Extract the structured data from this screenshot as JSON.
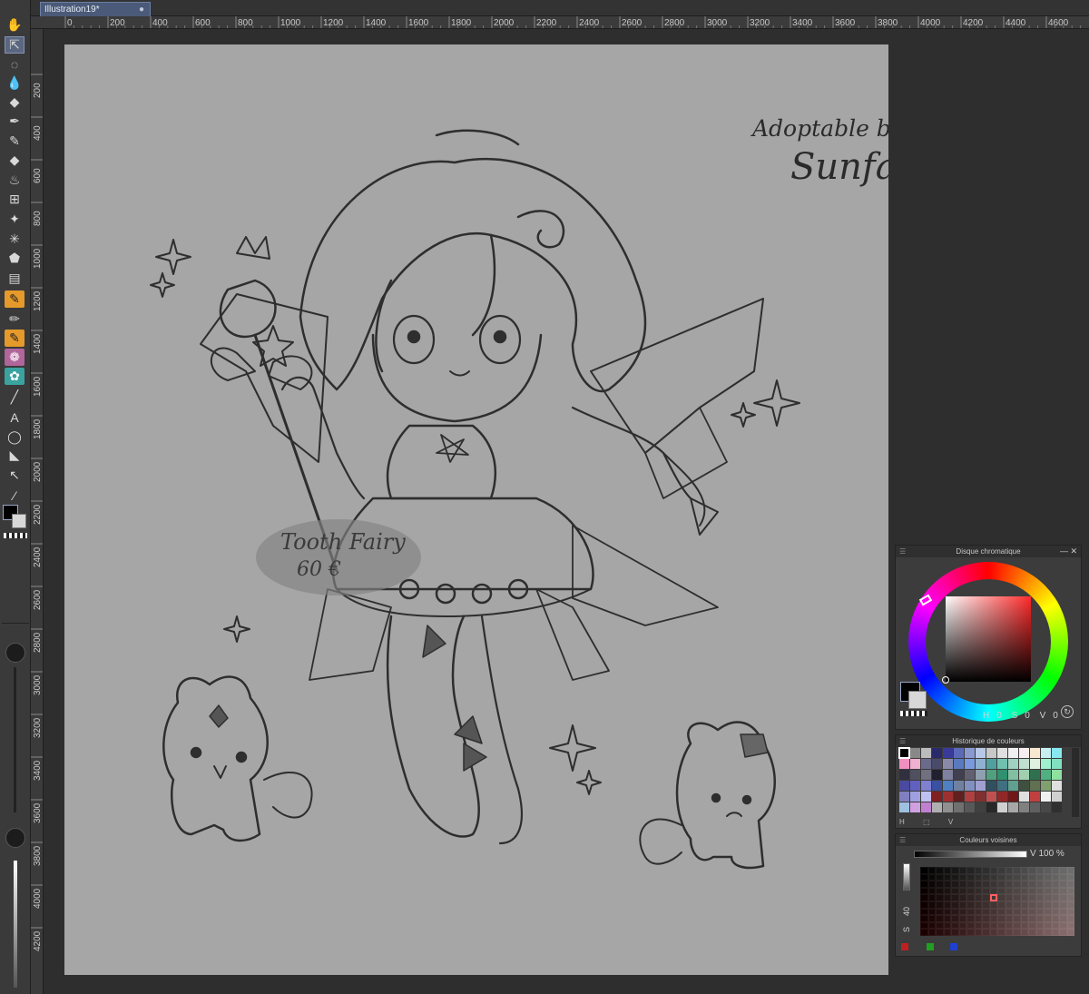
{
  "document": {
    "tab_title": "Illustration19*",
    "tab_close": "●"
  },
  "rulers": {
    "top_labels": [
      "0",
      "200",
      "400",
      "600",
      "800",
      "1000",
      "1200",
      "1400",
      "1600",
      "1800",
      "2000",
      "2200",
      "2400",
      "2600",
      "2800",
      "3000",
      "3200",
      "3400",
      "3600",
      "3800",
      "4000",
      "4200",
      "4400",
      "4600"
    ],
    "left_labels": [
      "200",
      "400",
      "600",
      "800",
      "1000",
      "1200",
      "1400",
      "1600",
      "1800",
      "2000",
      "2200",
      "2400",
      "2600",
      "2800",
      "3000",
      "3200",
      "3400",
      "3600",
      "3800",
      "4000",
      "4200"
    ]
  },
  "toolbar": {
    "tools": [
      {
        "name": "hand-tool",
        "icon": "hand-icon",
        "glyph": "✋"
      },
      {
        "name": "move-tool",
        "icon": "move-layer-icon",
        "glyph": "⇱"
      },
      {
        "name": "lasso-tool",
        "icon": "lasso-icon",
        "glyph": "◌"
      },
      {
        "name": "fill-tool",
        "icon": "drops-icon",
        "glyph": "💧"
      },
      {
        "name": "eraser-tool",
        "icon": "eraser-icon",
        "glyph": "◆"
      },
      {
        "name": "pen-tool",
        "icon": "pen-nib-icon",
        "glyph": "✒"
      },
      {
        "name": "pencil-tool",
        "icon": "pencil-icon",
        "glyph": "✎"
      },
      {
        "name": "eraser-tool-2",
        "icon": "eraser-icon",
        "glyph": "◆"
      },
      {
        "name": "blend-tool",
        "icon": "blend-icon",
        "glyph": "♨"
      },
      {
        "name": "grid-tool",
        "icon": "grid-icon",
        "glyph": "⊞"
      },
      {
        "name": "sparkle-tool",
        "icon": "sparkle-icon",
        "glyph": "✦"
      },
      {
        "name": "burst-tool",
        "icon": "burst-icon",
        "glyph": "✳"
      },
      {
        "name": "bucket-tool",
        "icon": "bucket-icon",
        "glyph": "⬟"
      },
      {
        "name": "gradient-tool",
        "icon": "gradient-icon",
        "glyph": "▤"
      },
      {
        "name": "brush-preset-1",
        "icon": "brush-icon",
        "glyph": "✎"
      },
      {
        "name": "pencil-preset",
        "icon": "pencil-icon",
        "glyph": "✏"
      },
      {
        "name": "brush-preset-2",
        "icon": "brush-icon",
        "glyph": "✎"
      },
      {
        "name": "watercolor-preset",
        "icon": "watercolor-icon",
        "glyph": "❁"
      },
      {
        "name": "texture-preset",
        "icon": "texture-icon",
        "glyph": "✿"
      },
      {
        "name": "line-tool",
        "icon": "line-icon",
        "glyph": "╱"
      },
      {
        "name": "text-tool",
        "icon": "text-icon",
        "glyph": "A"
      },
      {
        "name": "balloon-tool",
        "icon": "speech-balloon-icon",
        "glyph": "◯"
      },
      {
        "name": "frame-tool",
        "icon": "frame-icon",
        "glyph": "◣"
      },
      {
        "name": "object-tool",
        "icon": "object-select-icon",
        "glyph": "↖"
      },
      {
        "name": "eyedropper-tool",
        "icon": "eyedropper-icon",
        "glyph": "⁄"
      }
    ]
  },
  "artwork": {
    "signature_line1": "Adoptable by",
    "signature_line2": "Sunfangs",
    "price_title": "Tooth Fairy",
    "price_value": "60 €"
  },
  "color_wheel_panel": {
    "title": "Disque chromatique",
    "main_color": "#000000",
    "sub_color": "#d8d8d8",
    "readout_h_label": "H",
    "readout_h": "0",
    "readout_s_label": "S",
    "readout_s": "0",
    "readout_v_label": "V",
    "readout_v": "0"
  },
  "history_panel": {
    "title": "Historique de couleurs",
    "colors": [
      "#000000",
      "#888888",
      "#bbbbbb",
      "#2a2a6a",
      "#3a3a9a",
      "#5a6ab8",
      "#8a9ad0",
      "#b8c8e8",
      "#c8c8c8",
      "#e0e0e0",
      "#f0f0f0",
      "#f8f0f0",
      "#f8e8d0",
      "#c8f0f0",
      "#88e8f0",
      "#f090c0",
      "#f0b0d0",
      "#6a6a8a",
      "#4a4a6a",
      "#8a8aa8",
      "#5a7ac0",
      "#7a9ae0",
      "#90b0d0",
      "#50a0a0",
      "#70c0b0",
      "#a0d0c0",
      "#c0e0d0",
      "#e0f0e0",
      "#a0f0d0",
      "#80e0c0",
      "#303040",
      "#505060",
      "#707080",
      "#202030",
      "#8080a0",
      "#404050",
      "#606070",
      "#90a0b0",
      "#50a080",
      "#309070",
      "#80c0a0",
      "#a0d0b0",
      "#307050",
      "#50b080",
      "#90e0a0",
      "#4a4aa0",
      "#6060c0",
      "#8080d0",
      "#3a50a0",
      "#5080c0",
      "#7080a0",
      "#8090c0",
      "#a0a0d0",
      "#305060",
      "#407080",
      "#60a090",
      "#405040",
      "#607050",
      "#80a070",
      "#e0e0e0",
      "#8080c0",
      "#a0a0e0",
      "#c0c0f0",
      "#802020",
      "#a03030",
      "#602020",
      "#b04040",
      "#803030",
      "#c05050",
      "#902828",
      "#701818",
      "#e0e0e0",
      "#c04040",
      "#f0f0f0",
      "#d0d0d0",
      "#a0c0e0",
      "#d0a0e0",
      "#c080d0",
      "#b0b0b0",
      "#909090",
      "#707070",
      "#585858",
      "#404040",
      "#282828",
      "#d0d0d0",
      "#a8a8a8",
      "#808080",
      "#606060",
      "#484848",
      "#303030"
    ],
    "footer_labels": [
      "H",
      "⬚",
      "V"
    ]
  },
  "neighbor_panel": {
    "title": "Couleurs voisines",
    "v_label": "V 100 %",
    "side_label": "40",
    "side_label2": "S",
    "footer_colors": [
      "#c02020",
      "#20a020",
      "#2040d0"
    ]
  }
}
